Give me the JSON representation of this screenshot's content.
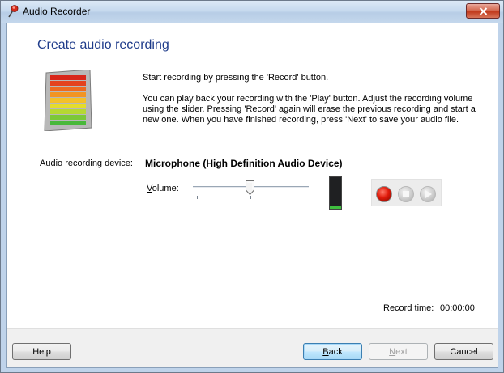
{
  "window": {
    "title": "Audio Recorder",
    "icon": "microphone-icon",
    "close_icon": "close-icon"
  },
  "main": {
    "heading": "Create audio recording",
    "instructions": [
      "Start recording by pressing the 'Record' button.",
      "You can play back your recording with the 'Play' button. Adjust the recording volume using the slider.  Pressing 'Record' again will erase the previous recording and start a new one. When you have finished recording, press 'Next' to save your audio file."
    ],
    "device": {
      "label": "Audio recording device:",
      "value": "Microphone (High Definition Audio Device)"
    },
    "volume": {
      "label_accel": "V",
      "label_rest": "olume:",
      "level_fraction": 0.49
    },
    "level_meter": {
      "fill_fraction": 0.1
    },
    "transport": {
      "record_icon": "record-icon",
      "stop_icon": "stop-icon",
      "play_icon": "play-icon"
    },
    "record_time": {
      "label": "Record time:",
      "value": "00:00:00"
    }
  },
  "footer": {
    "help_label": "Help",
    "back_accel": "B",
    "back_rest": "ack",
    "next_accel": "N",
    "next_rest": "ext",
    "cancel_label": "Cancel"
  },
  "colors": {
    "heading": "#1e3b8a",
    "record": "#e01a0a",
    "level": "#3fbf3f"
  }
}
